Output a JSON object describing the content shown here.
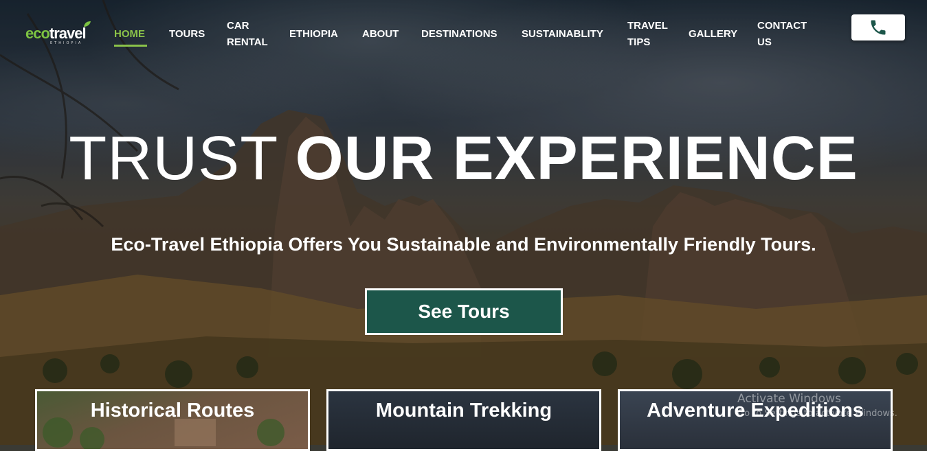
{
  "brand": {
    "logo_text_eco": "eco",
    "logo_text_travel": "travel",
    "logo_sub": "ETHIOPIA"
  },
  "nav": {
    "items": [
      {
        "label": "HOME",
        "active": true
      },
      {
        "label": "TOURS"
      },
      {
        "label": "CAR RENTAL"
      },
      {
        "label": "ETHIOPIA"
      },
      {
        "label": "ABOUT"
      },
      {
        "label": "DESTINATIONS"
      },
      {
        "label": "SUSTAINABLITY"
      },
      {
        "label": "TRAVEL TIPS"
      },
      {
        "label": "GALLERY"
      },
      {
        "label": "CONTACT US"
      }
    ],
    "phone_icon": "phone-icon"
  },
  "hero": {
    "title_light": "TRUST",
    "title_bold": "OUR EXPERIENCE",
    "subtitle": "Eco-Travel Ethiopia Offers You Sustainable and Environmentally Friendly Tours.",
    "cta_label": "See Tours"
  },
  "cards": [
    {
      "title": "Historical Routes"
    },
    {
      "title": "Mountain Trekking"
    },
    {
      "title": "Adventure Expeditions"
    }
  ],
  "watermark": {
    "line1": "Activate Windows",
    "line2": "Go to Settings to activate Windows."
  },
  "colors": {
    "accent": "#8bc34a",
    "cta_bg": "#1c564a",
    "phone_icon": "#1c564a"
  }
}
